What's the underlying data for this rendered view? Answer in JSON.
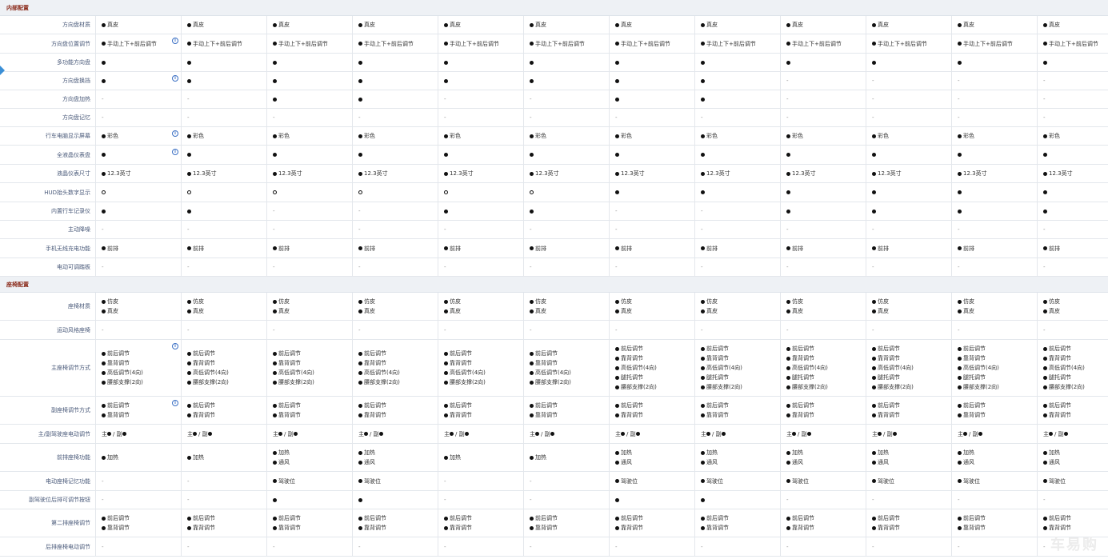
{
  "colors": {
    "section_title": "#8a2a1a",
    "label": "#4a5a7a",
    "section_bg": "#eef1f5",
    "info_icon": "#3a6fc4"
  },
  "watermark": "车易购",
  "info_glyph": "i",
  "sections": [
    {
      "title": "内部配置",
      "rows": [
        {
          "label": "方向盘材质",
          "h": 23,
          "info": false,
          "cells": [
            [
              "●真皮"
            ],
            [
              "●真皮"
            ],
            [
              "●真皮"
            ],
            [
              "●真皮"
            ],
            [
              "●真皮"
            ],
            [
              "●真皮"
            ],
            [
              "●真皮"
            ],
            [
              "●真皮"
            ],
            [
              "●真皮"
            ],
            [
              "●真皮"
            ],
            [
              "●真皮"
            ],
            [
              "●真皮"
            ]
          ]
        },
        {
          "label": "方向盘位置调节",
          "h": 24,
          "info": true,
          "cells": [
            [
              "●手动上下+前后调节"
            ],
            [
              "●手动上下+前后调节"
            ],
            [
              "●手动上下+前后调节"
            ],
            [
              "●手动上下+前后调节"
            ],
            [
              "●手动上下+前后调节"
            ],
            [
              "●手动上下+前后调节"
            ],
            [
              "●手动上下+前后调节"
            ],
            [
              "●手动上下+前后调节"
            ],
            [
              "●手动上下+前后调节"
            ],
            [
              "●手动上下+前后调节"
            ],
            [
              "●手动上下+前后调节"
            ],
            [
              "●手动上下+前后调节"
            ]
          ]
        },
        {
          "label": "多功能方向盘",
          "h": 23,
          "info": false,
          "cells": [
            [
              "●"
            ],
            [
              "●"
            ],
            [
              "●"
            ],
            [
              "●"
            ],
            [
              "●"
            ],
            [
              "●"
            ],
            [
              "●"
            ],
            [
              "●"
            ],
            [
              "●"
            ],
            [
              "●"
            ],
            [
              "●"
            ],
            [
              "●"
            ]
          ]
        },
        {
          "label": "方向盘换挡",
          "h": 23,
          "info": true,
          "cells": [
            [
              "●"
            ],
            [
              "●"
            ],
            [
              "●"
            ],
            [
              "●"
            ],
            [
              "●"
            ],
            [
              "●"
            ],
            [
              "●"
            ],
            [
              "●"
            ],
            [
              "-"
            ],
            [
              "-"
            ],
            [
              "-"
            ],
            [
              "-"
            ]
          ]
        },
        {
          "label": "方向盘加热",
          "h": 23,
          "info": false,
          "cells": [
            [
              "-"
            ],
            [
              "-"
            ],
            [
              "●"
            ],
            [
              "●"
            ],
            [
              "-"
            ],
            [
              "-"
            ],
            [
              "●"
            ],
            [
              "●"
            ],
            [
              "-"
            ],
            [
              "-"
            ],
            [
              "-"
            ],
            [
              "-"
            ]
          ]
        },
        {
          "label": "方向盘记忆",
          "h": 23,
          "info": false,
          "cells": [
            [
              "-"
            ],
            [
              "-"
            ],
            [
              "-"
            ],
            [
              "-"
            ],
            [
              "-"
            ],
            [
              "-"
            ],
            [
              "-"
            ],
            [
              "-"
            ],
            [
              "-"
            ],
            [
              "-"
            ],
            [
              "-"
            ],
            [
              "-"
            ]
          ]
        },
        {
          "label": "行车电脑显示屏幕",
          "h": 23,
          "info": true,
          "cells": [
            [
              "●彩色"
            ],
            [
              "●彩色"
            ],
            [
              "●彩色"
            ],
            [
              "●彩色"
            ],
            [
              "●彩色"
            ],
            [
              "●彩色"
            ],
            [
              "●彩色"
            ],
            [
              "●彩色"
            ],
            [
              "●彩色"
            ],
            [
              "●彩色"
            ],
            [
              "●彩色"
            ],
            [
              "●彩色"
            ]
          ]
        },
        {
          "label": "全液晶仪表盘",
          "h": 24,
          "info": true,
          "cells": [
            [
              "●"
            ],
            [
              "●"
            ],
            [
              "●"
            ],
            [
              "●"
            ],
            [
              "●"
            ],
            [
              "●"
            ],
            [
              "●"
            ],
            [
              "●"
            ],
            [
              "●"
            ],
            [
              "●"
            ],
            [
              "●"
            ],
            [
              "●"
            ]
          ]
        },
        {
          "label": "液晶仪表尺寸",
          "h": 23,
          "info": false,
          "cells": [
            [
              "●12.3英寸"
            ],
            [
              "●12.3英寸"
            ],
            [
              "●12.3英寸"
            ],
            [
              "●12.3英寸"
            ],
            [
              "●12.3英寸"
            ],
            [
              "●12.3英寸"
            ],
            [
              "●12.3英寸"
            ],
            [
              "●12.3英寸"
            ],
            [
              "●12.3英寸"
            ],
            [
              "●12.3英寸"
            ],
            [
              "●12.3英寸"
            ],
            [
              "●12.3英寸"
            ]
          ]
        },
        {
          "label": "HUD抬头数字显示",
          "h": 24,
          "info": false,
          "cells": [
            [
              "○"
            ],
            [
              "○"
            ],
            [
              "○"
            ],
            [
              "○"
            ],
            [
              "○"
            ],
            [
              "○"
            ],
            [
              "●"
            ],
            [
              "●"
            ],
            [
              "●"
            ],
            [
              "●"
            ],
            [
              "●"
            ],
            [
              "●"
            ]
          ]
        },
        {
          "label": "内置行车记录仪",
          "h": 23,
          "info": false,
          "cells": [
            [
              "●"
            ],
            [
              "●"
            ],
            [
              "-"
            ],
            [
              "-"
            ],
            [
              "●"
            ],
            [
              "●"
            ],
            [
              "-"
            ],
            [
              "-"
            ],
            [
              "●"
            ],
            [
              "●"
            ],
            [
              "●"
            ],
            [
              "●"
            ]
          ]
        },
        {
          "label": "主动降噪",
          "h": 23,
          "info": false,
          "cells": [
            [
              "-"
            ],
            [
              "-"
            ],
            [
              "-"
            ],
            [
              "-"
            ],
            [
              "-"
            ],
            [
              "-"
            ],
            [
              "-"
            ],
            [
              "-"
            ],
            [
              "-"
            ],
            [
              "-"
            ],
            [
              "-"
            ],
            [
              "-"
            ]
          ]
        },
        {
          "label": "手机无线充电功能",
          "h": 24,
          "info": false,
          "cells": [
            [
              "●前排"
            ],
            [
              "●前排"
            ],
            [
              "●前排"
            ],
            [
              "●前排"
            ],
            [
              "●前排"
            ],
            [
              "●前排"
            ],
            [
              "●前排"
            ],
            [
              "●前排"
            ],
            [
              "●前排"
            ],
            [
              "●前排"
            ],
            [
              "●前排"
            ],
            [
              "●前排"
            ]
          ]
        },
        {
          "label": "电动可调踏板",
          "h": 23,
          "info": false,
          "cells": [
            [
              "-"
            ],
            [
              "-"
            ],
            [
              "-"
            ],
            [
              "-"
            ],
            [
              "-"
            ],
            [
              "-"
            ],
            [
              "-"
            ],
            [
              "-"
            ],
            [
              "-"
            ],
            [
              "-"
            ],
            [
              "-"
            ],
            [
              "-"
            ]
          ]
        }
      ]
    },
    {
      "title": "座椅配置",
      "rows": [
        {
          "label": "座椅材质",
          "h": 35,
          "info": false,
          "cells": [
            [
              "●仿皮",
              "●真皮"
            ],
            [
              "●仿皮",
              "●真皮"
            ],
            [
              "●仿皮",
              "●真皮"
            ],
            [
              "●仿皮",
              "●真皮"
            ],
            [
              "●仿皮",
              "●真皮"
            ],
            [
              "●仿皮",
              "●真皮"
            ],
            [
              "●仿皮",
              "●真皮"
            ],
            [
              "●仿皮",
              "●真皮"
            ],
            [
              "●仿皮",
              "●真皮"
            ],
            [
              "●仿皮",
              "●真皮"
            ],
            [
              "●仿皮",
              "●真皮"
            ],
            [
              "●仿皮",
              "●真皮"
            ]
          ]
        },
        {
          "label": "运动风格座椅",
          "h": 24,
          "info": false,
          "cells": [
            [
              "-"
            ],
            [
              "-"
            ],
            [
              "-"
            ],
            [
              "-"
            ],
            [
              "-"
            ],
            [
              "-"
            ],
            [
              "-"
            ],
            [
              "-"
            ],
            [
              "-"
            ],
            [
              "-"
            ],
            [
              "-"
            ],
            [
              "-"
            ]
          ]
        },
        {
          "label": "主座椅调节方式",
          "h": 71,
          "info": true,
          "cells": [
            [
              "●前后调节",
              "●靠背调节",
              "●高低调节(4向)",
              "●腰部支撑(2向)"
            ],
            [
              "●前后调节",
              "●靠背调节",
              "●高低调节(4向)",
              "●腰部支撑(2向)"
            ],
            [
              "●前后调节",
              "●靠背调节",
              "●高低调节(4向)",
              "●腰部支撑(2向)"
            ],
            [
              "●前后调节",
              "●靠背调节",
              "●高低调节(4向)",
              "●腰部支撑(2向)"
            ],
            [
              "●前后调节",
              "●靠背调节",
              "●高低调节(4向)",
              "●腰部支撑(2向)"
            ],
            [
              "●前后调节",
              "●靠背调节",
              "●高低调节(4向)",
              "●腰部支撑(2向)"
            ],
            [
              "●前后调节",
              "●靠背调节",
              "●高低调节(4向)",
              "●腿托调节",
              "●腰部支撑(2向)"
            ],
            [
              "●前后调节",
              "●靠背调节",
              "●高低调节(4向)",
              "●腿托调节",
              "●腰部支撑(2向)"
            ],
            [
              "●前后调节",
              "●靠背调节",
              "●高低调节(4向)",
              "●腿托调节",
              "●腰部支撑(2向)"
            ],
            [
              "●前后调节",
              "●靠背调节",
              "●高低调节(4向)",
              "●腿托调节",
              "●腰部支撑(2向)"
            ],
            [
              "●前后调节",
              "●靠背调节",
              "●高低调节(4向)",
              "●腿托调节",
              "●腰部支撑(2向)"
            ],
            [
              "●前后调节",
              "●靠背调节",
              "●高低调节(4向)",
              "●腿托调节",
              "●腰部支撑(2向)"
            ]
          ]
        },
        {
          "label": "副座椅调节方式",
          "h": 35,
          "info": true,
          "cells": [
            [
              "●前后调节",
              "●靠背调节"
            ],
            [
              "●前后调节",
              "●靠背调节"
            ],
            [
              "●前后调节",
              "●靠背调节"
            ],
            [
              "●前后调节",
              "●靠背调节"
            ],
            [
              "●前后调节",
              "●靠背调节"
            ],
            [
              "●前后调节",
              "●靠背调节"
            ],
            [
              "●前后调节",
              "●靠背调节"
            ],
            [
              "●前后调节",
              "●靠背调节"
            ],
            [
              "●前后调节",
              "●靠背调节"
            ],
            [
              "●前后调节",
              "●靠背调节"
            ],
            [
              "●前后调节",
              "●靠背调节"
            ],
            [
              "●前后调节",
              "●靠背调节"
            ]
          ]
        },
        {
          "label": "主/副驾驶座电动调节",
          "h": 24,
          "info": false,
          "cells": [
            [
              "主● / 副●"
            ],
            [
              "主● / 副●"
            ],
            [
              "主● / 副●"
            ],
            [
              "主● / 副●"
            ],
            [
              "主● / 副●"
            ],
            [
              "主● / 副●"
            ],
            [
              "主● / 副●"
            ],
            [
              "主● / 副●"
            ],
            [
              "主● / 副●"
            ],
            [
              "主● / 副●"
            ],
            [
              "主● / 副●"
            ],
            [
              "主● / 副●"
            ]
          ]
        },
        {
          "label": "前排座椅功能",
          "h": 35,
          "info": false,
          "cells": [
            [
              "●加热"
            ],
            [
              "●加热"
            ],
            [
              "●加热",
              "●通风"
            ],
            [
              "●加热",
              "●通风"
            ],
            [
              "●加热"
            ],
            [
              "●加热"
            ],
            [
              "●加热",
              "●通风"
            ],
            [
              "●加热",
              "●通风"
            ],
            [
              "●加热",
              "●通风"
            ],
            [
              "●加热",
              "●通风"
            ],
            [
              "●加热",
              "●通风"
            ],
            [
              "●加热",
              "●通风"
            ]
          ]
        },
        {
          "label": "电动座椅记忆功能",
          "h": 24,
          "info": false,
          "cells": [
            [
              "-"
            ],
            [
              "-"
            ],
            [
              "●驾驶位"
            ],
            [
              "●驾驶位"
            ],
            [
              "-"
            ],
            [
              "-"
            ],
            [
              "●驾驶位"
            ],
            [
              "●驾驶位"
            ],
            [
              "●驾驶位"
            ],
            [
              "●驾驶位"
            ],
            [
              "●驾驶位"
            ],
            [
              "●驾驶位"
            ]
          ]
        },
        {
          "label": "副驾驶位后排可调节按钮",
          "h": 23,
          "info": false,
          "cells": [
            [
              "-"
            ],
            [
              "-"
            ],
            [
              "●"
            ],
            [
              "●"
            ],
            [
              "-"
            ],
            [
              "-"
            ],
            [
              "●"
            ],
            [
              "●"
            ],
            [
              "-"
            ],
            [
              "-"
            ],
            [
              "-"
            ],
            [
              "-"
            ]
          ]
        },
        {
          "label": "第二排座椅调节",
          "h": 35,
          "info": false,
          "cells": [
            [
              "●前后调节",
              "●靠背调节"
            ],
            [
              "●前后调节",
              "●靠背调节"
            ],
            [
              "●前后调节",
              "●靠背调节"
            ],
            [
              "●前后调节",
              "●靠背调节"
            ],
            [
              "●前后调节",
              "●靠背调节"
            ],
            [
              "●前后调节",
              "●靠背调节"
            ],
            [
              "●前后调节",
              "●靠背调节"
            ],
            [
              "●前后调节",
              "●靠背调节"
            ],
            [
              "●前后调节",
              "●靠背调节"
            ],
            [
              "●前后调节",
              "●靠背调节"
            ],
            [
              "●前后调节",
              "●靠背调节"
            ],
            [
              "●前后调节",
              "●靠背调节"
            ]
          ]
        },
        {
          "label": "后排座椅电动调节",
          "h": 24,
          "info": false,
          "cells": [
            [
              "-"
            ],
            [
              "-"
            ],
            [
              "-"
            ],
            [
              "-"
            ],
            [
              "-"
            ],
            [
              "-"
            ],
            [
              "-"
            ],
            [
              "-"
            ],
            [
              "-"
            ],
            [
              "-"
            ],
            [
              "-"
            ],
            [
              "-"
            ]
          ]
        }
      ]
    }
  ]
}
